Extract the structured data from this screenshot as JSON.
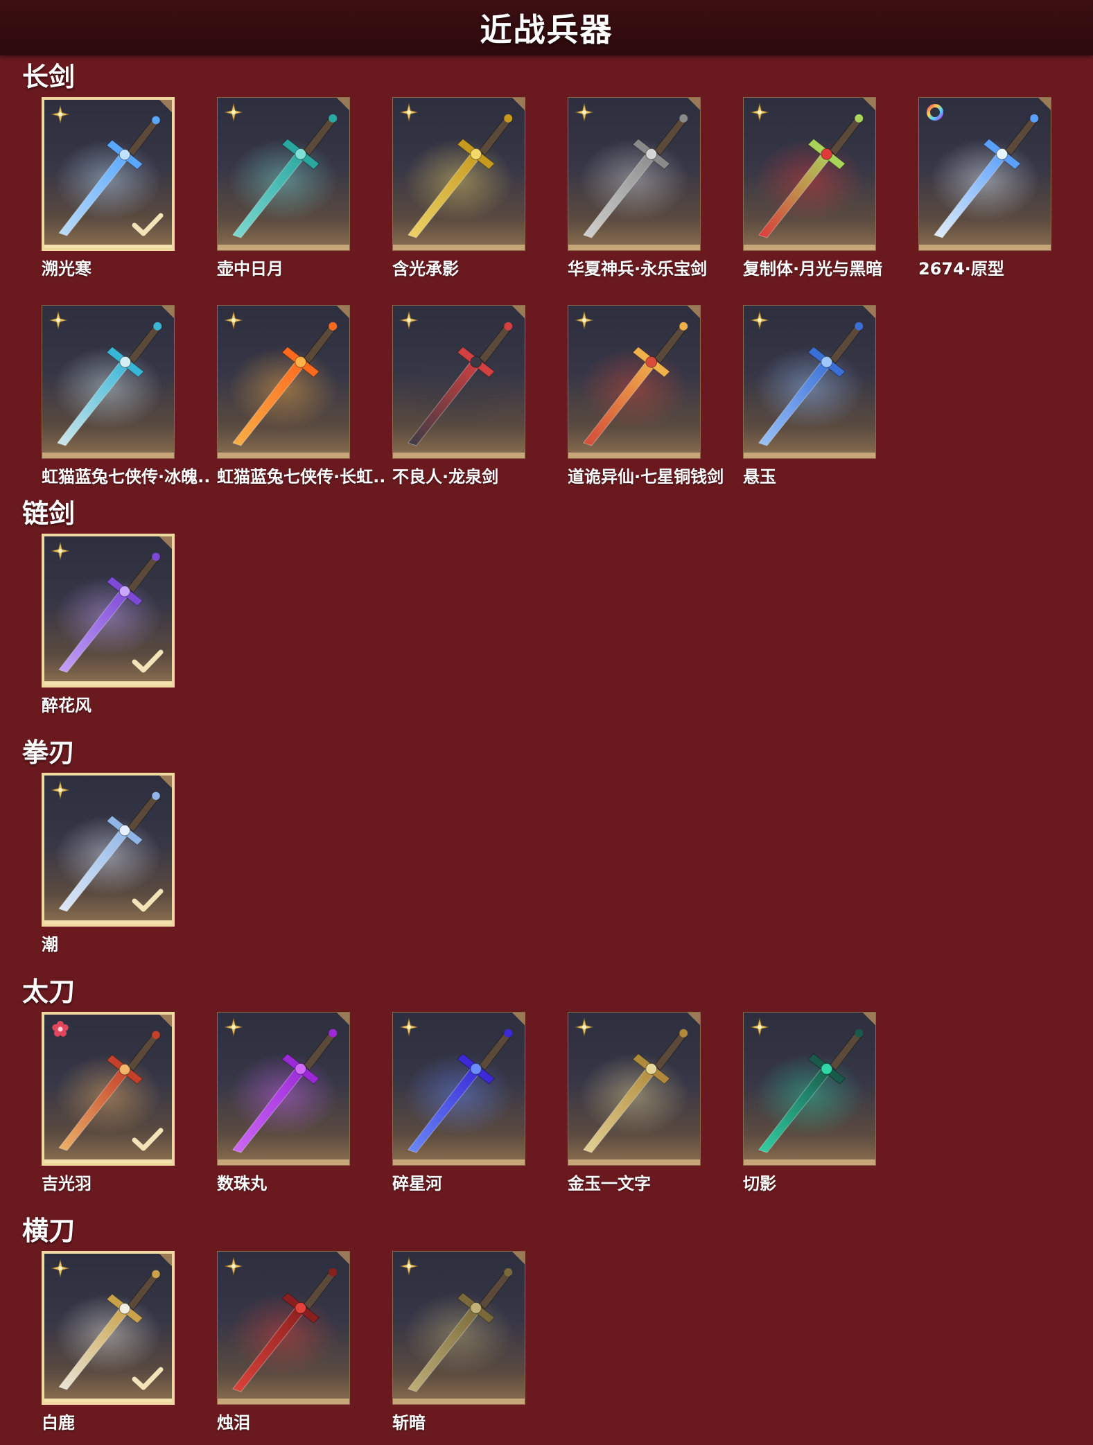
{
  "header": {
    "title": "近战兵器"
  },
  "categories": [
    {
      "name": "长剑",
      "items": [
        {
          "name": "溯光寒",
          "rarity_icon": "gold-sparkle-icon",
          "selected": true,
          "colors": [
            "#bfe3ff",
            "#5aa7ff"
          ]
        },
        {
          "name": "壶中日月",
          "rarity_icon": "gold-sparkle-icon",
          "selected": false,
          "colors": [
            "#7fe0d8",
            "#2aa79f"
          ]
        },
        {
          "name": "含光承影",
          "rarity_icon": "gold-sparkle-icon",
          "selected": false,
          "colors": [
            "#f3d86a",
            "#c69a1f"
          ]
        },
        {
          "name": "华夏神兵·永乐宝剑",
          "rarity_icon": "gold-sparkle-icon",
          "selected": false,
          "colors": [
            "#d6d6d6",
            "#8a8a8a"
          ]
        },
        {
          "name": "复制体·月光与黑暗",
          "rarity_icon": "gold-sparkle-icon",
          "selected": false,
          "colors": [
            "#e23a3a",
            "#a8d45a"
          ]
        },
        {
          "name": "2674·原型",
          "rarity_icon": "rainbow-ring-icon",
          "selected": false,
          "colors": [
            "#e8f4ff",
            "#5b9fff"
          ]
        },
        {
          "name": "虹猫蓝兔七侠传·冰魄..",
          "rarity_icon": "gold-sparkle-icon",
          "selected": false,
          "colors": [
            "#d5eef2",
            "#38b6d6"
          ]
        },
        {
          "name": "虹猫蓝兔七侠传·长虹..",
          "rarity_icon": "gold-sparkle-icon",
          "selected": false,
          "colors": [
            "#ffb347",
            "#ff6a1f"
          ]
        },
        {
          "name": "不良人·龙泉剑",
          "rarity_icon": "gold-sparkle-icon",
          "selected": false,
          "colors": [
            "#3a3a44",
            "#d24040"
          ]
        },
        {
          "name": "道诡异仙·七星铜钱剑",
          "rarity_icon": "gold-sparkle-icon",
          "selected": false,
          "colors": [
            "#d94a3a",
            "#f0b04a"
          ]
        },
        {
          "name": "悬玉",
          "rarity_icon": "gold-sparkle-icon",
          "selected": false,
          "colors": [
            "#9ec8ff",
            "#3a6fd6"
          ]
        }
      ]
    },
    {
      "name": "链剑",
      "items": [
        {
          "name": "醉花风",
          "rarity_icon": "gold-sparkle-icon",
          "selected": true,
          "colors": [
            "#c9a6ff",
            "#7c4ad6"
          ]
        }
      ]
    },
    {
      "name": "拳刃",
      "items": [
        {
          "name": "潮",
          "rarity_icon": "gold-sparkle-icon",
          "selected": true,
          "colors": [
            "#e6f0ff",
            "#8fb6e6"
          ]
        }
      ]
    },
    {
      "name": "太刀",
      "items": [
        {
          "name": "吉光羽",
          "rarity_icon": "red-flower-icon",
          "selected": true,
          "colors": [
            "#f2b66a",
            "#c4402a"
          ]
        },
        {
          "name": "数珠丸",
          "rarity_icon": "gold-sparkle-icon",
          "selected": false,
          "colors": [
            "#d36aff",
            "#9b2ad6"
          ]
        },
        {
          "name": "碎星河",
          "rarity_icon": "gold-sparkle-icon",
          "selected": false,
          "colors": [
            "#6a8cff",
            "#3b2ad6"
          ]
        },
        {
          "name": "金玉一文字",
          "rarity_icon": "gold-sparkle-icon",
          "selected": false,
          "colors": [
            "#e8d79a",
            "#b08a3a"
          ]
        },
        {
          "name": "切影",
          "rarity_icon": "gold-sparkle-icon",
          "selected": false,
          "colors": [
            "#2fd6a8",
            "#1a5a4a"
          ]
        }
      ]
    },
    {
      "name": "横刀",
      "items": [
        {
          "name": "白鹿",
          "rarity_icon": "gold-sparkle-icon",
          "selected": true,
          "colors": [
            "#f1ede0",
            "#c9a24a"
          ]
        },
        {
          "name": "烛泪",
          "rarity_icon": "gold-sparkle-icon",
          "selected": false,
          "colors": [
            "#e2423a",
            "#8a1f1f"
          ]
        },
        {
          "name": "斩暗",
          "rarity_icon": "gold-sparkle-icon",
          "selected": false,
          "colors": [
            "#c2b27a",
            "#7a6a3a"
          ]
        }
      ]
    }
  ]
}
